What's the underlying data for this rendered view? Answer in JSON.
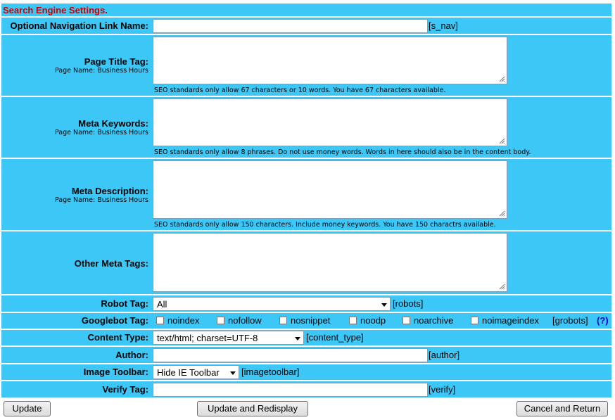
{
  "header": {
    "title": "Search Engine Settings."
  },
  "nav_link": {
    "label": "Optional Navigation Link Name:",
    "value": "",
    "code": "[s_nav]"
  },
  "page_title": {
    "label": "Page Title Tag:",
    "sub": "Page Name: Business Hours",
    "value": "",
    "note": "SEO standards only allow 67 characters or 10 words. You have 67 characters available."
  },
  "meta_keywords": {
    "label": "Meta Keywords:",
    "sub": "Page Name: Business Hours",
    "value": "",
    "note": "SEO standards only allow 8 phrases. Do not use money words. Words in here should also be in the content body."
  },
  "meta_description": {
    "label": "Meta Description:",
    "sub": "Page Name: Business Hours",
    "value": "",
    "note": "SEO standards only allow 150 characters. Include money keywords. You have 150 charactrs available."
  },
  "other_meta": {
    "label": "Other Meta Tags:",
    "value": ""
  },
  "robot": {
    "label": "Robot Tag:",
    "selected": "All",
    "code": "[robots]"
  },
  "googlebot": {
    "label": "Googlebot Tag:",
    "options": [
      "noindex",
      "nofollow",
      "nosnippet",
      "noodp",
      "noarchive",
      "noimageindex"
    ],
    "code": "[grobots]",
    "help": "(?)"
  },
  "content_type": {
    "label": "Content Type:",
    "selected": "text/html; charset=UTF-8",
    "code": "[content_type]"
  },
  "author": {
    "label": "Author:",
    "value": "",
    "code": "[author]"
  },
  "image_toolbar": {
    "label": "Image Toolbar:",
    "selected": "Hide IE Toolbar",
    "code": "[imagetoolbar]"
  },
  "verify": {
    "label": "Verify Tag:",
    "value": "",
    "code": "[verify]"
  },
  "buttons": {
    "update": "Update",
    "update_redisplay": "Update and Redisplay",
    "cancel_return": "Cancel and Return"
  },
  "colors": {
    "row_bg": "#3cc7f6",
    "title_red": "#cc0000",
    "help_blue": "#0000cc"
  }
}
